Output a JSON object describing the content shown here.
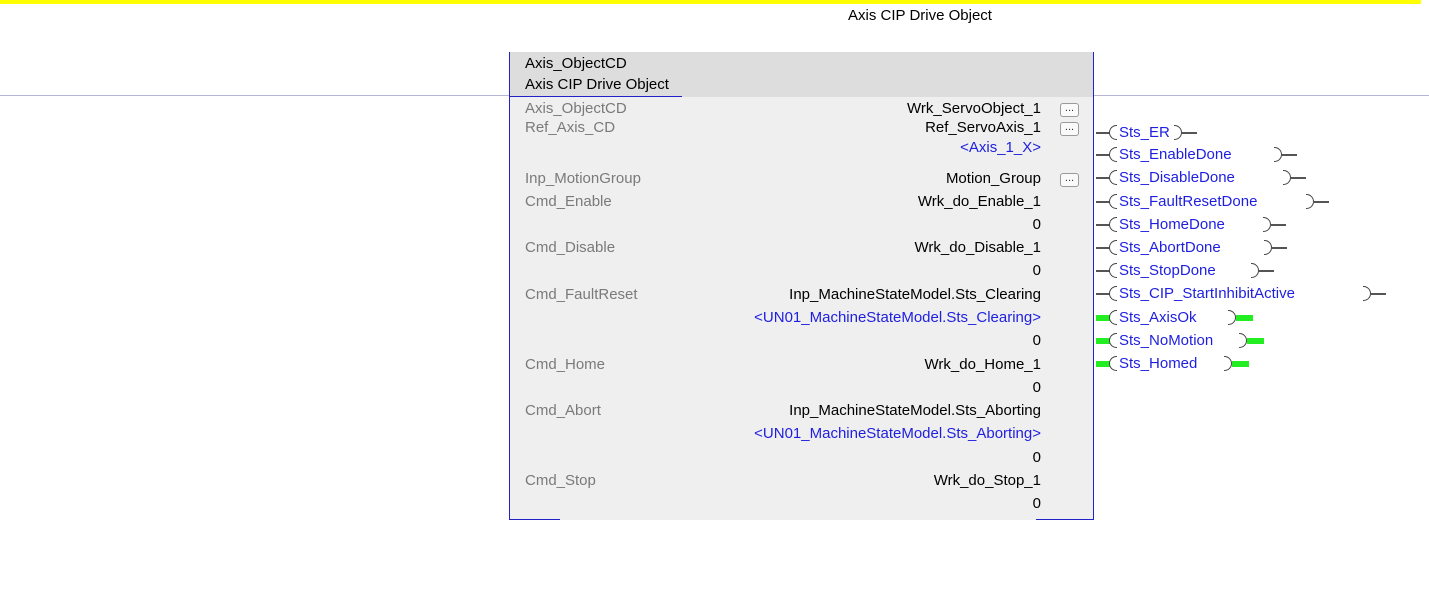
{
  "block_type_title": "Axis CIP Drive Object",
  "instruction": {
    "tag": "Axis_ObjectCD",
    "description": "Axis CIP Drive Object"
  },
  "params": [
    {
      "name": "Axis_ObjectCD",
      "value": "Wrk_ServoObject_1",
      "has_browse": true
    },
    {
      "name": "Ref_Axis_CD",
      "value": "Ref_ServoAxis_1",
      "has_browse": true,
      "alias": "<Axis_1_X>"
    },
    {
      "name": "Inp_MotionGroup",
      "value": "Motion_Group",
      "has_browse": true
    },
    {
      "name": "Cmd_Enable",
      "value": "Wrk_do_Enable_1",
      "current": "0"
    },
    {
      "name": "Cmd_Disable",
      "value": "Wrk_do_Disable_1",
      "current": "0"
    },
    {
      "name": "Cmd_FaultReset",
      "value": "Inp_MachineStateModel.Sts_Clearing",
      "alias": "<UN01_MachineStateModel.Sts_Clearing>",
      "current": "0"
    },
    {
      "name": "Cmd_Home",
      "value": "Wrk_do_Home_1",
      "current": "0"
    },
    {
      "name": "Cmd_Abort",
      "value": "Inp_MachineStateModel.Sts_Aborting",
      "alias": "<UN01_MachineStateModel.Sts_Aborting>",
      "current": "0"
    },
    {
      "name": "Cmd_Stop",
      "value": "Wrk_do_Stop_1",
      "current": "0"
    }
  ],
  "browse_button_label": "...",
  "outputs": [
    {
      "label": "Sts_ER",
      "energized": false
    },
    {
      "label": "Sts_EnableDone",
      "energized": false
    },
    {
      "label": "Sts_DisableDone",
      "energized": false
    },
    {
      "label": "Sts_FaultResetDone",
      "energized": false
    },
    {
      "label": "Sts_HomeDone",
      "energized": false
    },
    {
      "label": "Sts_AbortDone",
      "energized": false
    },
    {
      "label": "Sts_StopDone",
      "energized": false
    },
    {
      "label": "Sts_CIP_StartInhibitActive",
      "energized": false
    },
    {
      "label": "Sts_AxisOk",
      "energized": true
    },
    {
      "label": "Sts_NoMotion",
      "energized": true
    },
    {
      "label": "Sts_Homed",
      "energized": true
    }
  ],
  "colors": {
    "rung_highlight": "#ffff00",
    "alias_text": "#1e1ee0",
    "energized": "#22ee22"
  }
}
